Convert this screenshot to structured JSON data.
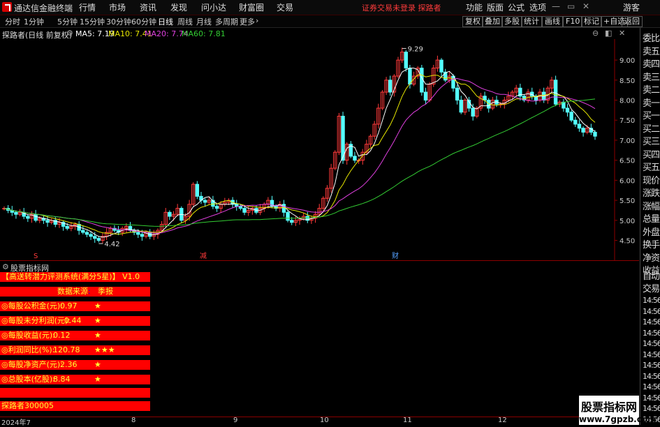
{
  "titlebar": {
    "app_title": "通达信金融终端",
    "menu": [
      "行情",
      "市场",
      "资讯",
      "发现",
      "问小达",
      "财富圈",
      "交易"
    ],
    "warning": "证券交易未登录  探路者",
    "right_menu": [
      "功能",
      "版面",
      "公式",
      "选项"
    ],
    "guest": "游客",
    "accent": "#d40000"
  },
  "tabs": {
    "periods": [
      "分时",
      "1分钟",
      "5分钟",
      "15分钟",
      "30分钟",
      "60分钟",
      "日线",
      "周线",
      "月线",
      "多周期",
      "更多"
    ],
    "active": "日线",
    "buttons": [
      "复权",
      "叠加",
      "多股",
      "统计",
      "画线",
      "F10",
      "标记",
      "+自选",
      "返回"
    ]
  },
  "info": {
    "stock": "探路者(日线 前复权)",
    "ma5": "MA5: 7.19",
    "ma10": "MA10: 7.41",
    "ma20": "MA20: 7.74",
    "ma60": "MA60: 7.81"
  },
  "chart_data": {
    "type": "candlestick",
    "price_axis_ticks": [
      "9.00",
      "8.50",
      "8.00",
      "7.50",
      "7.00",
      "6.50",
      "6.00",
      "5.50",
      "5.00",
      "4.50"
    ],
    "ylim": [
      4.3,
      9.35
    ],
    "annotations": {
      "high": "9.29",
      "low": "4.42"
    },
    "markers": [
      "S",
      "减",
      "财"
    ],
    "x_axis_labels": [
      "2024年7",
      "8",
      "9",
      "10",
      "11",
      "12"
    ],
    "series": [
      {
        "name": "MA5",
        "color": "#ffffff"
      },
      {
        "name": "MA10",
        "color": "#e6e600"
      },
      {
        "name": "MA20",
        "color": "#e040e0"
      },
      {
        "name": "MA60",
        "color": "#33cc33"
      }
    ],
    "close": [
      5.3,
      5.25,
      5.2,
      5.15,
      5.2,
      5.1,
      5.05,
      5.15,
      5.0,
      5.05,
      5.0,
      4.95,
      5.0,
      4.9,
      4.95,
      4.85,
      4.8,
      4.85,
      4.9,
      4.75,
      4.7,
      4.65,
      4.6,
      4.55,
      4.5,
      4.6,
      4.7,
      4.8,
      4.75,
      4.7,
      4.8,
      4.85,
      4.75,
      4.7,
      4.65,
      4.6,
      4.7,
      4.6,
      4.65,
      4.75,
      4.9,
      5.2,
      5.1,
      5.15,
      5.3,
      5.0,
      5.1,
      5.4,
      5.9,
      5.6,
      5.5,
      5.45,
      5.5,
      5.35,
      5.3,
      5.4,
      5.45,
      5.5,
      5.4,
      5.35,
      5.3,
      5.2,
      5.25,
      5.3,
      5.2,
      5.3,
      5.4,
      5.5,
      5.35,
      5.3,
      5.4,
      5.2,
      5.0,
      4.95,
      5.0,
      5.05,
      5.1,
      5.0,
      5.05,
      5.15,
      5.3,
      5.55,
      5.8,
      6.3,
      6.7,
      7.6,
      6.5,
      6.9,
      6.6,
      6.5,
      6.5,
      6.7,
      6.9,
      7.1,
      7.4,
      7.8,
      8.2,
      8.5,
      8.2,
      8.6,
      9.0,
      9.2,
      8.8,
      8.4,
      8.6,
      8.8,
      8.2,
      8.0,
      8.4,
      8.8,
      9.0,
      8.7,
      8.5,
      8.6,
      8.3,
      8.0,
      7.7,
      8.0,
      7.8,
      7.6,
      7.8,
      8.1,
      8.0,
      7.8,
      8.0,
      7.9,
      7.9,
      8.0,
      8.1,
      8.2,
      8.3,
      8.1,
      8.0,
      8.2,
      8.1,
      8.0,
      8.2,
      8.0,
      8.3,
      8.5,
      7.9,
      7.95,
      7.8,
      7.7,
      7.5,
      7.4,
      7.3,
      7.2,
      7.3,
      7.2,
      7.1
    ]
  },
  "indicator": {
    "panel_title": "股票指标网",
    "header": "【高送转潜力评测系统(满分5星)】 V1.0",
    "source_row": {
      "label": "数据来源",
      "value": "季报"
    },
    "rows": [
      {
        "label": "◎每股公积金(元):",
        "value": "0.97",
        "stars": "★"
      },
      {
        "label": "◎每股未分利润(元):",
        "value": "0.44",
        "stars": "★"
      },
      {
        "label": "◎每股收益(元):",
        "value": "0.12",
        "stars": "★"
      },
      {
        "label": "◎利润同比(%):",
        "value": "120.78",
        "stars": "★★★"
      },
      {
        "label": "◎每股净资产(元):",
        "value": "2.36",
        "stars": "★"
      },
      {
        "label": "◎总股本(亿股):",
        "value": "8.84",
        "stars": "★"
      }
    ],
    "footer": "探路者300005"
  },
  "right_panel": {
    "items": [
      "委比",
      "卖五",
      "卖四",
      "卖三",
      "卖二",
      "卖一",
      "买一",
      "买二",
      "买三",
      "买四",
      "买五",
      "现价",
      "涨跌",
      "涨幅",
      "总量",
      "外盘",
      "换手",
      "净资",
      "收益"
    ],
    "auto": "自动",
    "trade": "交易",
    "times": [
      "14:56",
      "14:56",
      "14:56",
      "14:56",
      "14:56",
      "14:56",
      "14:56",
      "14:56",
      "14:56",
      "14:56",
      "14:56",
      "14:56"
    ]
  },
  "watermark": {
    "line1": "股票指标网",
    "line2": "www.7gpzb.com"
  }
}
